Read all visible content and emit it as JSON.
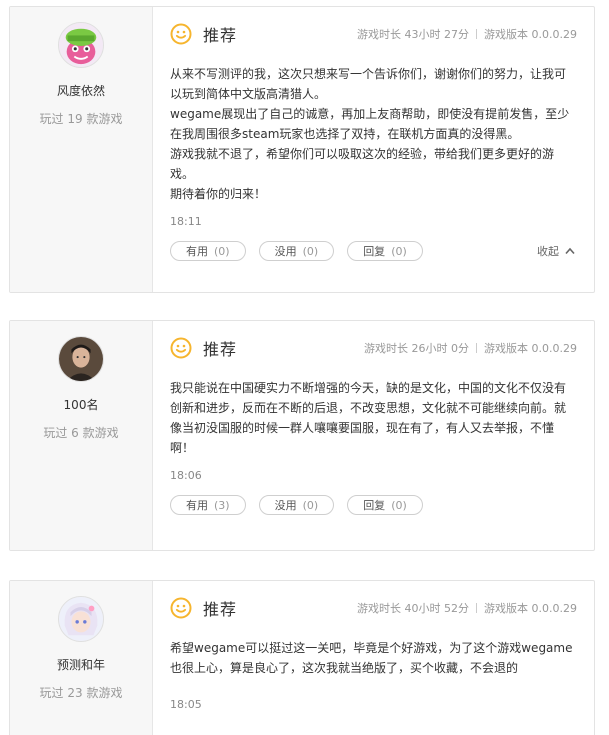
{
  "reviews": [
    {
      "user": {
        "name": "风度依然",
        "played": "玩过 19 款游戏",
        "avatar_icon": "cartoon-avatar-green-hat"
      },
      "rating": {
        "icon": "smile-icon",
        "label": "推荐"
      },
      "playtime": "游戏时长 43小时 27分",
      "version": "游戏版本 0.0.0.29",
      "text": "从来不写测评的我，这次只想来写一个告诉你们，谢谢你们的努力，让我可以玩到简体中文版高清猎人。\nwegame展现出了自己的诚意，再加上友商帮助，即使没有提前发售，至少在我周围很多steam玩家也选择了双持，在联机方面真的没得黑。\n游戏我就不退了，希望你们可以吸取这次的经验，带给我们更多更好的游戏。\n期待着你的归来！",
      "time": "18:11",
      "actions": {
        "useful_label": "有用",
        "useful_count": "(0)",
        "useless_label": "没用",
        "useless_count": "(0)",
        "reply_label": "回复",
        "reply_count": "(0)"
      },
      "collapse_label": "收起"
    },
    {
      "user": {
        "name": "100名",
        "played": "玩过 6 款游戏",
        "avatar_icon": "photo-avatar-man"
      },
      "rating": {
        "icon": "smile-icon",
        "label": "推荐"
      },
      "playtime": "游戏时长 26小时 0分",
      "version": "游戏版本 0.0.0.29",
      "text": "我只能说在中国硬实力不断增强的今天，缺的是文化，中国的文化不仅没有创新和进步，反而在不断的后退，不改变思想，文化就不可能继续向前。就像当初没国服的时候一群人嚷嚷要国服，现在有了，有人又去举报，不懂啊！",
      "time": "18:06",
      "actions": {
        "useful_label": "有用",
        "useful_count": "(3)",
        "useless_label": "没用",
        "useless_count": "(0)",
        "reply_label": "回复",
        "reply_count": "(0)"
      }
    },
    {
      "user": {
        "name": "预测和年",
        "played": "玩过 23 款游戏",
        "avatar_icon": "anime-avatar-girl"
      },
      "rating": {
        "icon": "smile-icon",
        "label": "推荐"
      },
      "playtime": "游戏时长 40小时 52分",
      "version": "游戏版本 0.0.0.29",
      "text": "希望wegame可以挺过这一关吧，毕竟是个好游戏，为了这个游戏wegame也很上心，算是良心了，这次我就当绝版了，买个收藏，不会退的",
      "time": "18:05"
    }
  ],
  "colors": {
    "accent_yellow": "#f6b52e",
    "border": "#e3e3e3",
    "sidebar_bg": "#f7f7f7"
  }
}
